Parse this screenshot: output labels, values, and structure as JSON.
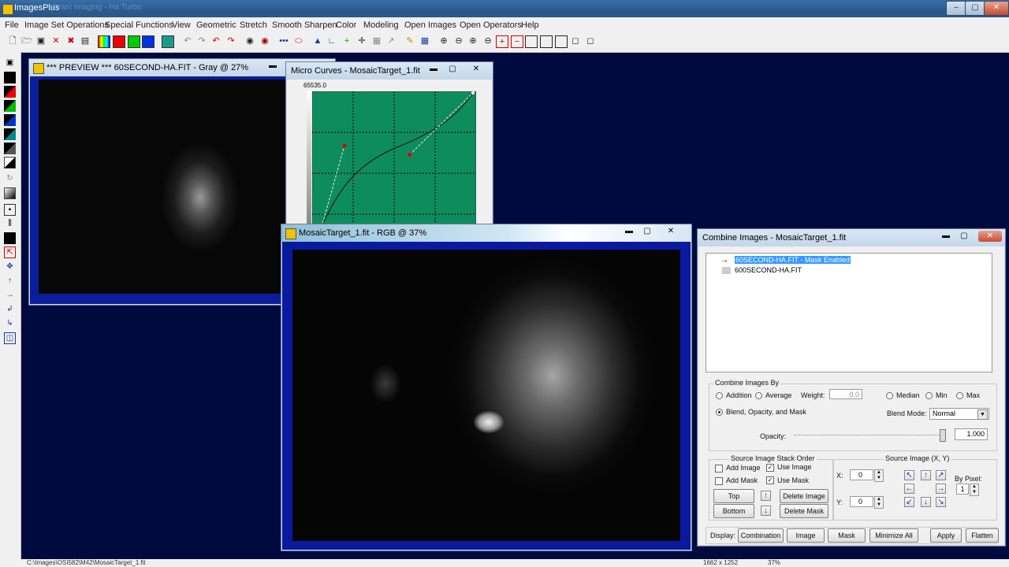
{
  "app": {
    "title": "ImagesPlus",
    "faded_title": "Grant Imaging - Ha Turbo"
  },
  "menu": [
    "File",
    "Image Set Operations",
    "Special Functions",
    "View",
    "Geometric",
    "Stretch",
    "Smooth Sharpen",
    "Color",
    "Modeling",
    "Open Images",
    "Open Operators",
    "Help"
  ],
  "preview_window": {
    "title": "*** PREVIEW *** 60SECOND-HA.FIT - Gray @ 27%"
  },
  "curves_window": {
    "title": "Micro Curves - MosaicTarget_1.fit",
    "max_value": "65535.0"
  },
  "mosaic_window": {
    "title": "MosaicTarget_1.fit - RGB @ 37%"
  },
  "combine_dialog": {
    "title": "Combine Images - MosaicTarget_1.fit",
    "stack_items": [
      "60SECOND-HA.FIT - Mask Enabled",
      "600SECOND-HA.FIT"
    ],
    "combine_by_label": "Combine Images By",
    "addition": "Addition",
    "average": "Average",
    "weight_label": "Weight:",
    "weight_value": "0.0",
    "median": "Median",
    "min": "Min",
    "max": "Max",
    "blend": "Blend, Opacity, and Mask",
    "blend_mode_label": "Blend Mode:",
    "blend_mode_value": "Normal",
    "opacity_label": "Opacity:",
    "opacity_value": "1.000",
    "stack_order_label": "Source Image Stack Order",
    "add_image": "Add Image",
    "use_image": "Use Image",
    "add_mask": "Add Mask",
    "use_mask": "Use Mask",
    "top": "Top",
    "bottom": "Bottom",
    "delete_image": "Delete Image",
    "delete_mask": "Delete Mask",
    "source_xy_label": "Source Image (X, Y)",
    "x_label": "X:",
    "x_value": "0",
    "y_label": "Y:",
    "y_value": "0",
    "by_pixel_label": "By Pixel:",
    "by_pixel_value": "1",
    "display_label": "Display:",
    "combination": "Combination",
    "image": "Image",
    "mask": "Mask",
    "minimize_all": "Minimize All",
    "apply": "Apply",
    "flatten": "Flatten"
  },
  "status": {
    "path": "C:\\Images\\OSI582\\M42\\MosaicTarget_1.fit",
    "size": "1662 x 1252",
    "zoom": "37%"
  },
  "colors": {
    "desktop": "#000a3f",
    "window_blue_frame": "#0012a0",
    "curves_green": "#0f8c5e",
    "selection": "#3399ff"
  }
}
